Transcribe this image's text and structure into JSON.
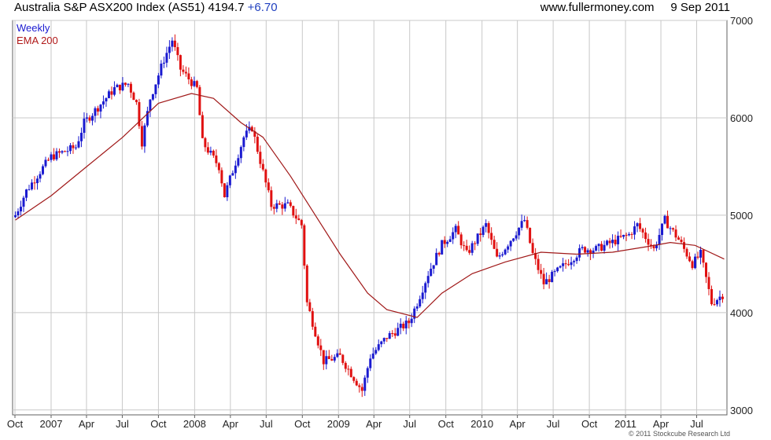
{
  "header": {
    "title": "Australia S&P ASX200 Index (AS51) 4194.7",
    "change": "+6.70",
    "source_and_date": "www.fullermoney.com     9 Sep 2011"
  },
  "footer": {
    "copyright": "© 2011 Stockcube Research Ltd"
  },
  "colors": {
    "up": "#1a1ad0",
    "down": "#e01010",
    "ema": "#a01818",
    "grid": "#c8c8c8",
    "frame": "#606060"
  },
  "chart_data": {
    "type": "candlestick",
    "title": "Australia S&P ASX200 Index (AS51)",
    "legend": [
      "Weekly",
      "EMA 200"
    ],
    "legend_placement": "top-left",
    "y_axis_side": "right",
    "ylim": [
      2950,
      7000
    ],
    "yticks": [
      3000,
      4000,
      5000,
      6000,
      7000
    ],
    "x_range": [
      "2006-09-25",
      "2011-09-16"
    ],
    "xticks": [
      {
        "label": "Oct",
        "date": "2006-10-01"
      },
      {
        "label": "2007",
        "date": "2007-01-01"
      },
      {
        "label": "Apr",
        "date": "2007-04-01"
      },
      {
        "label": "Jul",
        "date": "2007-07-01"
      },
      {
        "label": "Oct",
        "date": "2007-10-01"
      },
      {
        "label": "2008",
        "date": "2008-01-01"
      },
      {
        "label": "Apr",
        "date": "2008-04-01"
      },
      {
        "label": "Jul",
        "date": "2008-07-01"
      },
      {
        "label": "Oct",
        "date": "2008-10-01"
      },
      {
        "label": "2009",
        "date": "2009-01-01"
      },
      {
        "label": "Apr",
        "date": "2009-04-01"
      },
      {
        "label": "Jul",
        "date": "2009-07-01"
      },
      {
        "label": "Oct",
        "date": "2009-10-01"
      },
      {
        "label": "2010",
        "date": "2010-01-01"
      },
      {
        "label": "Apr",
        "date": "2010-04-01"
      },
      {
        "label": "Jul",
        "date": "2010-07-01"
      },
      {
        "label": "Oct",
        "date": "2010-10-01"
      },
      {
        "label": "2011",
        "date": "2011-01-01"
      },
      {
        "label": "Apr",
        "date": "2011-04-01"
      },
      {
        "label": "Jul",
        "date": "2011-07-01"
      }
    ],
    "close_path": [
      [
        "2006-10-02",
        5000
      ],
      [
        "2006-10-30",
        5250
      ],
      [
        "2006-12-04",
        5450
      ],
      [
        "2007-01-01",
        5600
      ],
      [
        "2007-03-05",
        5700
      ],
      [
        "2007-03-26",
        5950
      ],
      [
        "2007-06-11",
        6300
      ],
      [
        "2007-07-16",
        6350
      ],
      [
        "2007-08-06",
        6150
      ],
      [
        "2007-08-20",
        5750
      ],
      [
        "2007-09-10",
        6200
      ],
      [
        "2007-10-15",
        6600
      ],
      [
        "2007-11-05",
        6800
      ],
      [
        "2007-11-26",
        6500
      ],
      [
        "2008-01-07",
        6300
      ],
      [
        "2008-01-21",
        5750
      ],
      [
        "2008-03-03",
        5500
      ],
      [
        "2008-03-17",
        5200
      ],
      [
        "2008-05-05",
        5800
      ],
      [
        "2008-05-26",
        5900
      ],
      [
        "2008-07-14",
        5100
      ],
      [
        "2008-08-25",
        5100
      ],
      [
        "2008-09-29",
        4900
      ],
      [
        "2008-10-13",
        4100
      ],
      [
        "2008-11-10",
        3700
      ],
      [
        "2008-11-24",
        3500
      ],
      [
        "2009-01-05",
        3550
      ],
      [
        "2009-03-02",
        3200
      ],
      [
        "2009-03-23",
        3550
      ],
      [
        "2009-05-04",
        3750
      ],
      [
        "2009-06-29",
        3900
      ],
      [
        "2009-07-20",
        4100
      ],
      [
        "2009-08-17",
        4400
      ],
      [
        "2009-09-21",
        4700
      ],
      [
        "2009-10-26",
        4850
      ],
      [
        "2009-11-23",
        4600
      ],
      [
        "2010-01-11",
        4900
      ],
      [
        "2010-02-08",
        4550
      ],
      [
        "2010-04-19",
        4950
      ],
      [
        "2010-05-10",
        4600
      ],
      [
        "2010-06-07",
        4300
      ],
      [
        "2010-07-05",
        4400
      ],
      [
        "2010-08-02",
        4500
      ],
      [
        "2010-09-13",
        4650
      ],
      [
        "2010-10-18",
        4650
      ],
      [
        "2010-11-15",
        4700
      ],
      [
        "2011-01-10",
        4800
      ],
      [
        "2011-01-31",
        4900
      ],
      [
        "2011-03-14",
        4650
      ],
      [
        "2011-04-11",
        4950
      ],
      [
        "2011-05-16",
        4750
      ],
      [
        "2011-06-20",
        4500
      ],
      [
        "2011-07-11",
        4600
      ],
      [
        "2011-08-08",
        4100
      ],
      [
        "2011-09-09",
        4195
      ]
    ],
    "ema_200": [
      [
        "2006-10-02",
        4950
      ],
      [
        "2007-01-01",
        5200
      ],
      [
        "2007-04-02",
        5500
      ],
      [
        "2007-07-02",
        5800
      ],
      [
        "2007-10-01",
        6150
      ],
      [
        "2007-12-24",
        6250
      ],
      [
        "2008-02-18",
        6200
      ],
      [
        "2008-04-28",
        5950
      ],
      [
        "2008-06-23",
        5800
      ],
      [
        "2008-09-01",
        5400
      ],
      [
        "2008-11-03",
        5000
      ],
      [
        "2009-01-05",
        4600
      ],
      [
        "2009-03-16",
        4200
      ],
      [
        "2009-05-04",
        4030
      ],
      [
        "2009-07-20",
        3950
      ],
      [
        "2009-09-21",
        4200
      ],
      [
        "2009-12-07",
        4400
      ],
      [
        "2010-03-01",
        4520
      ],
      [
        "2010-05-31",
        4620
      ],
      [
        "2010-08-30",
        4600
      ],
      [
        "2010-11-29",
        4620
      ],
      [
        "2011-02-28",
        4680
      ],
      [
        "2011-04-25",
        4720
      ],
      [
        "2011-06-27",
        4690
      ],
      [
        "2011-09-09",
        4550
      ]
    ]
  }
}
